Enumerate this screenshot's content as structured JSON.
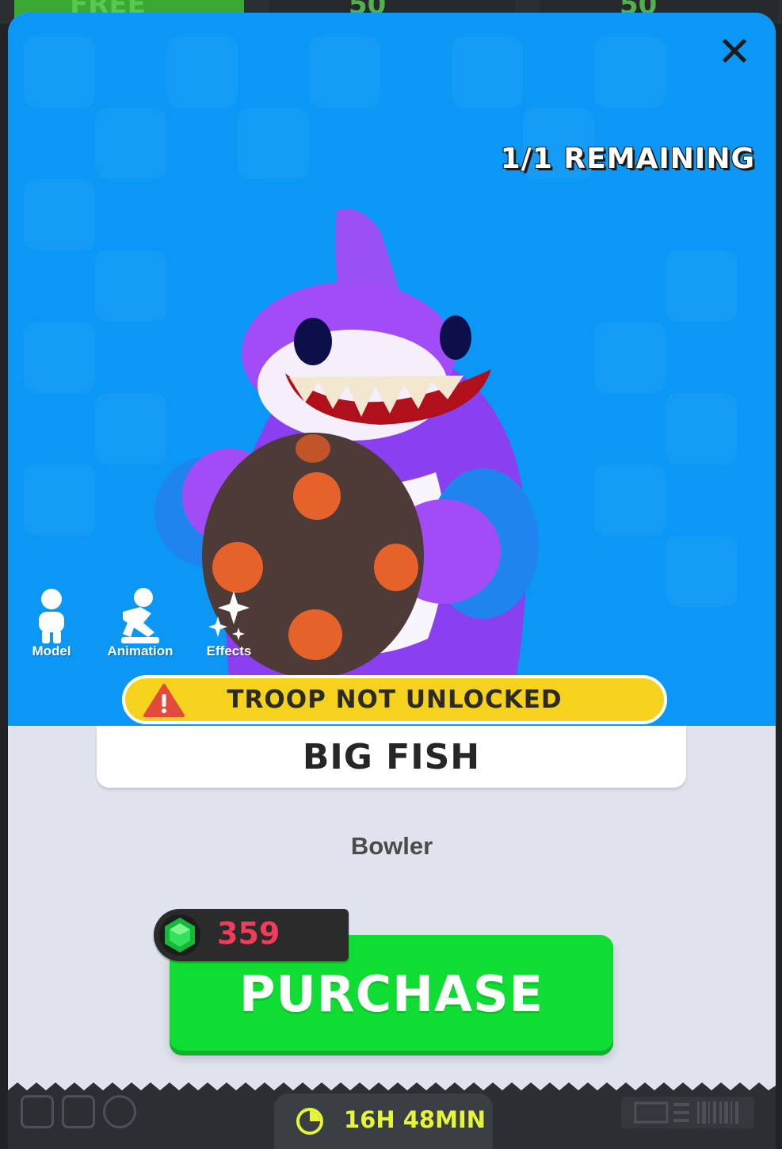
{
  "background": {
    "tab_labels": [
      "FREE",
      "50",
      "50"
    ]
  },
  "modal": {
    "close_icon": "close-icon",
    "remaining_text": "1/1 REMAINING",
    "character_icon": "shark-character-with-spiked-ball",
    "view_options": [
      {
        "label": "Model",
        "icon": "person-icon"
      },
      {
        "label": "Animation",
        "icon": "running-person-icon"
      },
      {
        "label": "Effects",
        "icon": "sparkles-icon"
      }
    ],
    "warning": {
      "icon": "warning-triangle-icon",
      "text": "TROOP NOT UNLOCKED",
      "color": "#f4d21e"
    },
    "troop_name": "BIG FISH",
    "troop_class": "Bowler",
    "price": {
      "icon": "green-gem-icon",
      "amount": "359",
      "color": "#f13d5a"
    },
    "purchase_label": "PURCHASE",
    "purchase_color": "#10dd33",
    "hero_color": "#0a97f5"
  },
  "footer": {
    "timer_icon": "clock-icon",
    "timer_text": "16H 48MIN",
    "timer_color": "#e4f53a"
  }
}
